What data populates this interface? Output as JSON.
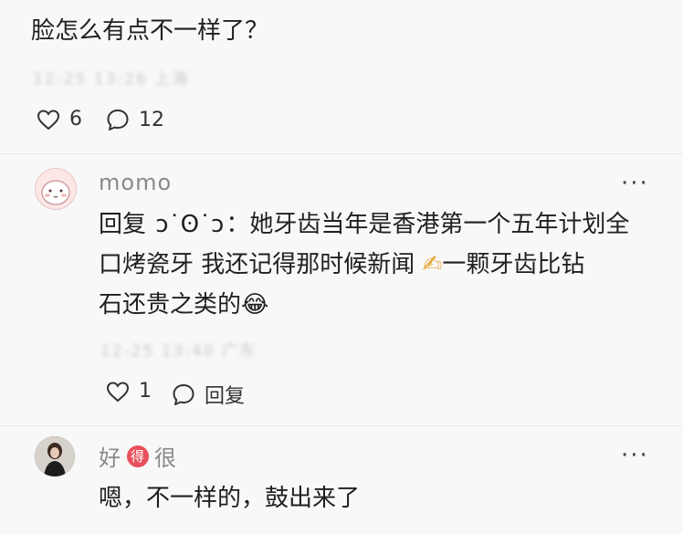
{
  "top_comment": {
    "text": "脸怎么有点不一样了？",
    "meta_blurred": "12-25 13:26 上海",
    "likes": "6",
    "replies": "12"
  },
  "reply1": {
    "username": "momo",
    "reply_prefix": "回复",
    "reply_to": "ↄ˙ʘ˙ↄ",
    "line1_text": "：她牙齿当年是香港第一个五年计划全",
    "line2_text": "口烤瓷牙 我还记得那时候新闻",
    "line2_emoji": "✍",
    "line2_tail": "一颗牙齿比钻",
    "line3_text": "石还贵之类的",
    "line3_emoji": "😂",
    "meta_blurred": "12-25 13:40 广东",
    "likes": "1",
    "reply_label": "回复"
  },
  "reply2": {
    "username_part1": "好",
    "username_badge": "得",
    "username_part2": "很",
    "text": "嗯，不一样的，鼓出来了"
  },
  "icons": {
    "like": "heart-outline-icon",
    "comment": "speech-bubble-icon",
    "more": "more-dots-icon"
  },
  "colors": {
    "badge": "#e8505b",
    "avatar_bg": "#fde6e6"
  }
}
